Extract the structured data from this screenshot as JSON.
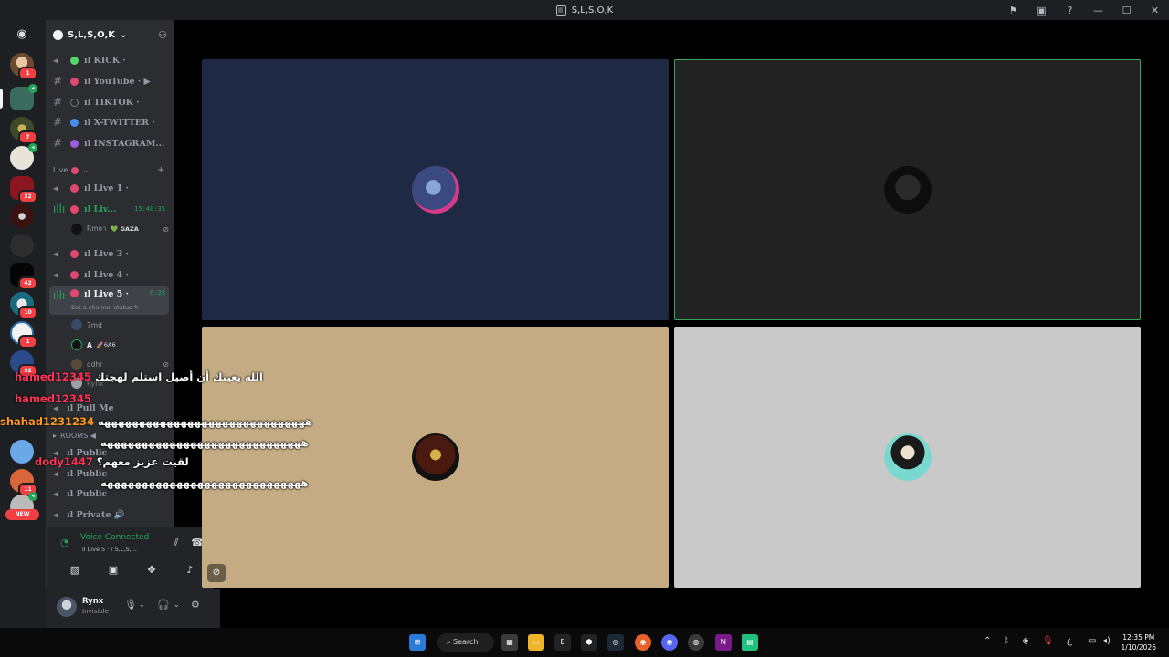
{
  "window": {
    "title": "S,L,S,O,K",
    "controls": [
      "flag-icon",
      "screen-icon",
      "help-icon",
      "minimize",
      "maximize",
      "close"
    ]
  },
  "server": {
    "name": "S,L,S,O,K",
    "rail_badges": [
      "1",
      "7",
      "32",
      "42",
      "10",
      "1",
      "92",
      "11"
    ],
    "new_label": "NEW"
  },
  "channels": [
    {
      "name": "ıl KICK ·",
      "type": "voice"
    },
    {
      "name": "ıl YouTube · ▶",
      "type": "text"
    },
    {
      "name": "ıl TIKTOK ·",
      "type": "text"
    },
    {
      "name": "ıl X-TWITTER ·",
      "type": "text"
    },
    {
      "name": "ıl INSTAGRAM...",
      "type": "text"
    }
  ],
  "live_category": {
    "name": "Live",
    "channels": [
      {
        "name": "ıl Live 1 ·"
      },
      {
        "name": "ıl Liv...",
        "timer": "15:40:35"
      },
      {
        "name": "ıl Live 3 ·"
      },
      {
        "name": "ıl Live 4 ·"
      },
      {
        "name": "ıl Live 5 ·",
        "timer": "6:23"
      }
    ],
    "live2_user": {
      "name": "Rmoา",
      "tag": "💚 GAZA"
    },
    "live5_status": "Set a channel status ✎",
    "live5_users": [
      "7md",
      "A",
      "odhr",
      "Rynx"
    ],
    "live5_user_tag": "🚀6A6"
  },
  "rooms": {
    "category": "ROOMS ◀",
    "channels": [
      "ıl Pull Me",
      "ıl Public",
      "ıl Public",
      "ıl Public",
      "ıl Private 🔊"
    ]
  },
  "voice": {
    "connected": "Voice Connected",
    "location": "ıl Live 5 · / S,L,S,..."
  },
  "user": {
    "name": "Rynx",
    "status": "Invisible"
  },
  "chat": [
    {
      "name": "hamed12345",
      "name_color": "#ff3355",
      "message": "الله يعينك أن أصيل استلم لهجتك"
    },
    {
      "name": "hamed12345",
      "name_color": "#ff3355",
      "message": ""
    },
    {
      "name": "shahad1231234",
      "name_color": "#ff9a1f",
      "message": "ههههههههههههههههههههههههههههههه"
    },
    {
      "name": "",
      "name_color": "#ffffff",
      "message": "هههههههههههههههههههههههههههههه"
    },
    {
      "name": "dody1447",
      "name_color": "#ff3355",
      "message": "لقيت عزيز معهم؟"
    },
    {
      "name": "",
      "name_color": "#ffffff",
      "message": "هههههههههههههههههههههههههههههه"
    }
  ],
  "tiles": [
    {
      "bg": "#1e2a44",
      "border": "none"
    },
    {
      "bg": "#222222",
      "border": "#3ba55c"
    },
    {
      "bg": "#c4ab84",
      "border": "none",
      "muted": true
    },
    {
      "bg": "#c9c9c9",
      "border": "none"
    }
  ],
  "taskbar": {
    "search_label": "Search",
    "time": "12:35 PM",
    "date": "1/10/2026",
    "lang": "ع"
  }
}
